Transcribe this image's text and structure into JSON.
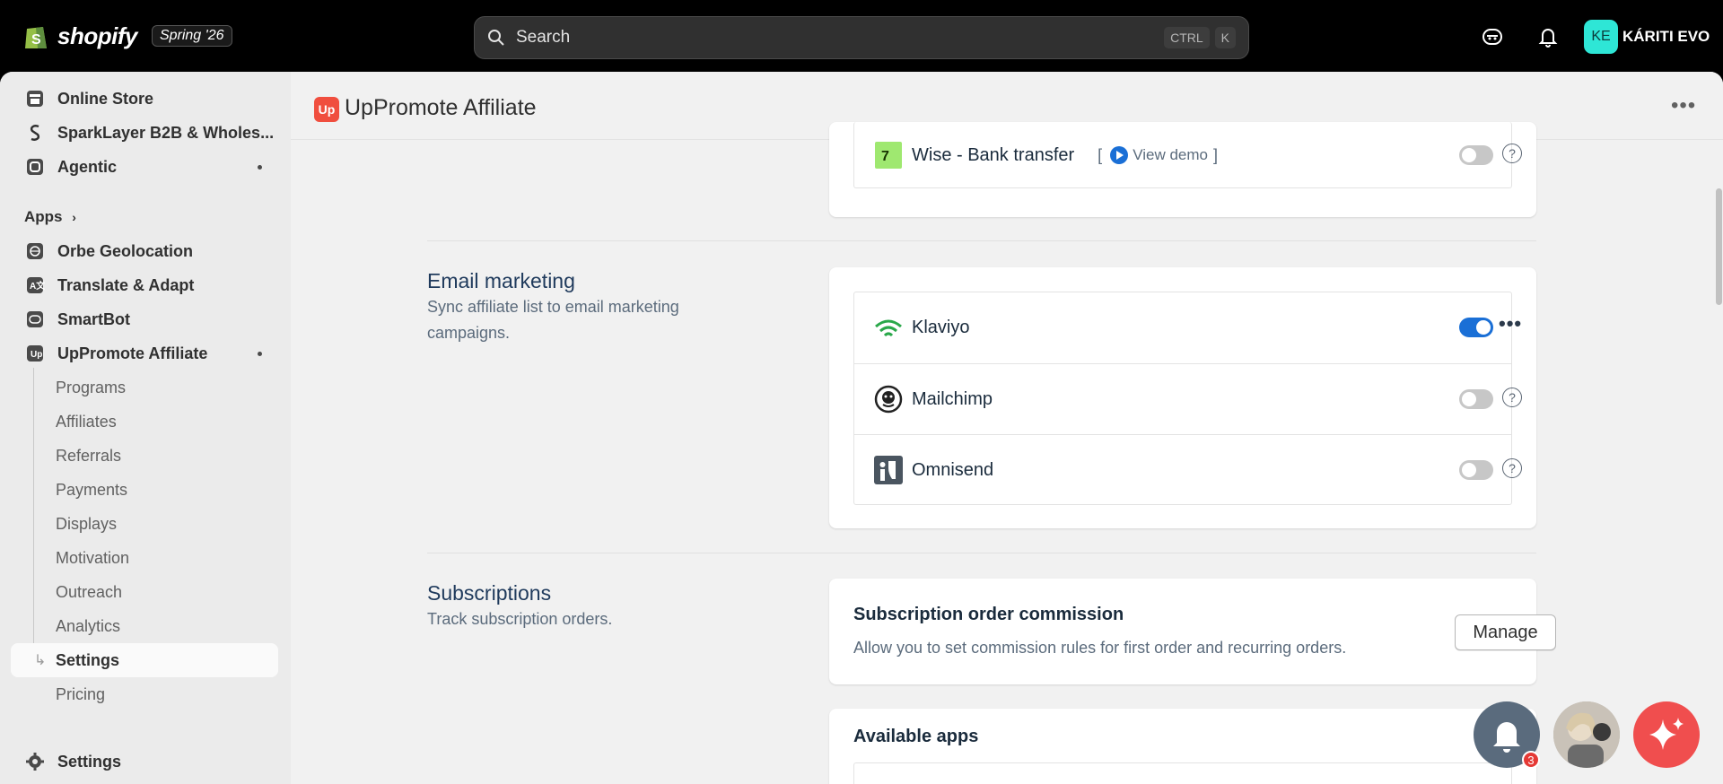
{
  "topbar": {
    "brand": "shopify",
    "badge": "Spring '26",
    "search_placeholder": "Search",
    "shortcut_ctrl": "CTRL",
    "shortcut_key": "K",
    "avatar_initials": "KE",
    "store_name": "KÁRITI EVO"
  },
  "sidebar": {
    "top_items": [
      {
        "label": "Online Store"
      },
      {
        "label": "SparkLayer B2B & Wholes..."
      },
      {
        "label": "Agentic"
      }
    ],
    "apps_label": "Apps",
    "app_items": [
      {
        "label": "Orbe Geolocation"
      },
      {
        "label": "Translate & Adapt"
      },
      {
        "label": "SmartBot"
      },
      {
        "label": "UpPromote Affiliate"
      }
    ],
    "sub_items": [
      {
        "label": "Programs"
      },
      {
        "label": "Affiliates"
      },
      {
        "label": "Referrals"
      },
      {
        "label": "Payments"
      },
      {
        "label": "Displays"
      },
      {
        "label": "Motivation"
      },
      {
        "label": "Outreach"
      },
      {
        "label": "Analytics"
      },
      {
        "label": "Settings"
      },
      {
        "label": "Pricing"
      }
    ],
    "bottom_settings": "Settings"
  },
  "header": {
    "app_title": "UpPromote Affiliate",
    "more": "•••"
  },
  "payment": {
    "name": "Wise - Bank transfer",
    "demo_link": "View demo",
    "bracket_open": "[",
    "bracket_close": "]",
    "enabled": false
  },
  "email_marketing": {
    "title": "Email marketing",
    "description": "Sync affiliate list to email marketing campaigns.",
    "integrations": [
      {
        "name": "Klaviyo",
        "enabled": true
      },
      {
        "name": "Mailchimp",
        "enabled": false
      },
      {
        "name": "Omnisend",
        "enabled": false
      }
    ]
  },
  "subscriptions": {
    "title": "Subscriptions",
    "description": "Track subscription orders.",
    "card_title": "Subscription order commission",
    "card_desc": "Allow you to set commission rules for first order and recurring orders.",
    "manage_label": "Manage",
    "available_apps_title": "Available apps"
  },
  "floating": {
    "notification_count": "3"
  },
  "colors": {
    "accent_blue": "#1a6fd6",
    "uppromote_red": "#f04e3e",
    "avatar_teal": "#2ee6d6"
  }
}
